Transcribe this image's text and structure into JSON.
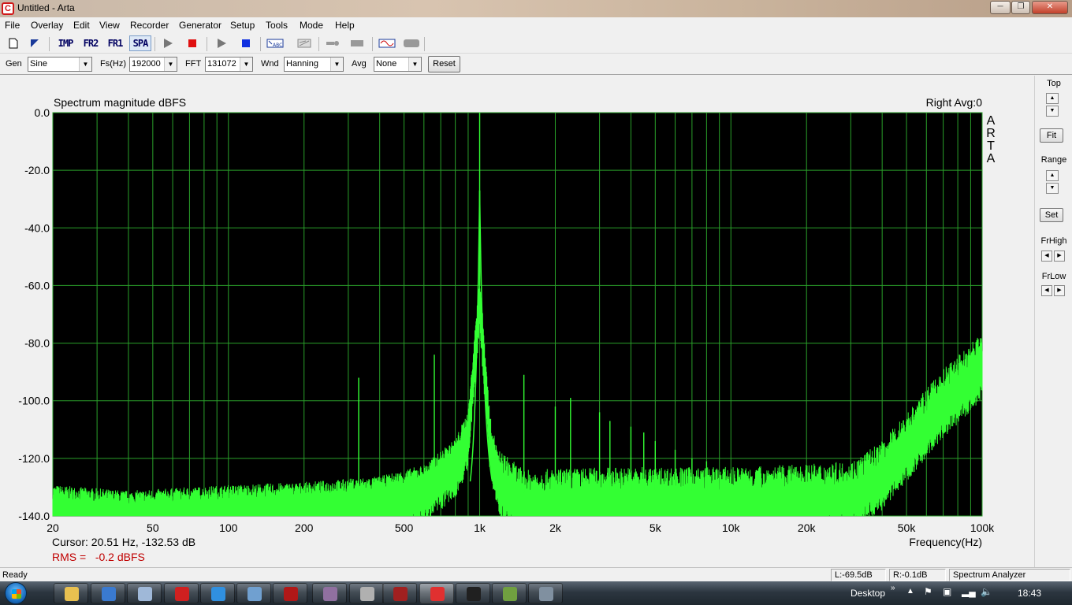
{
  "window": {
    "title": "Untitled - Arta",
    "app_icon_letter": "C"
  },
  "menu": [
    "File",
    "Overlay",
    "Edit",
    "View",
    "Recorder",
    "Generator",
    "Setup",
    "Tools",
    "Mode",
    "Help"
  ],
  "toolbar": {
    "buttons": [
      {
        "name": "new-file-icon",
        "type": "icon"
      },
      {
        "name": "open-file-icon",
        "type": "icon"
      },
      {
        "name": "imp-mode-button",
        "label": "IMP",
        "type": "text"
      },
      {
        "name": "fr2-mode-button",
        "label": "FR2",
        "type": "text"
      },
      {
        "name": "fr1-mode-button",
        "label": "FR1",
        "type": "text"
      },
      {
        "name": "spa-mode-button",
        "label": "SPA",
        "type": "text",
        "active": true
      },
      {
        "name": "play-icon",
        "type": "icon"
      },
      {
        "name": "stop-icon",
        "type": "icon"
      },
      {
        "name": "play-icon",
        "type": "icon"
      },
      {
        "name": "stop-icon",
        "type": "icon"
      },
      {
        "name": "abc-icon",
        "type": "icon"
      },
      {
        "name": "calibrate-icon",
        "type": "icon"
      },
      {
        "name": "probe-icon",
        "type": "icon"
      },
      {
        "name": "bar-icon",
        "type": "icon"
      },
      {
        "name": "generator-icon",
        "type": "icon"
      },
      {
        "name": "record-icon",
        "type": "icon"
      }
    ]
  },
  "controls": {
    "gen_label": "Gen",
    "gen_value": "Sine",
    "fs_label": "Fs(Hz)",
    "fs_value": "192000",
    "fft_label": "FFT",
    "fft_value": "131072",
    "wnd_label": "Wnd",
    "wnd_value": "Hanning",
    "avg_label": "Avg",
    "avg_value": "None",
    "reset_label": "Reset"
  },
  "plot": {
    "info_right": "Right  Avg:0",
    "watermark": "ARTA",
    "cursor_text": "Cursor: 20.51 Hz, -132.53 dB",
    "rms_text": "RMS =   -0.2 dBFS",
    "colors": {
      "background": "#000000",
      "grid": "#2aa02a",
      "trace": "#33ff33",
      "rms": "#c00000"
    }
  },
  "chart_data": {
    "type": "line",
    "title": "Spectrum magnitude dBFS",
    "xlabel": "Frequency(Hz)",
    "ylabel": "",
    "xscale": "log",
    "xlim": [
      20,
      100000
    ],
    "ylim": [
      -140,
      0
    ],
    "xticks": [
      {
        "v": 20,
        "label": "20"
      },
      {
        "v": 50,
        "label": "50"
      },
      {
        "v": 100,
        "label": "100"
      },
      {
        "v": 200,
        "label": "200"
      },
      {
        "v": 500,
        "label": "500"
      },
      {
        "v": 1000,
        "label": "1k"
      },
      {
        "v": 2000,
        "label": "2k"
      },
      {
        "v": 5000,
        "label": "5k"
      },
      {
        "v": 10000,
        "label": "10k"
      },
      {
        "v": 20000,
        "label": "20k"
      },
      {
        "v": 50000,
        "label": "50k"
      },
      {
        "v": 100000,
        "label": "100k"
      }
    ],
    "yticks": [
      {
        "v": 0,
        "label": "0.0"
      },
      {
        "v": -20,
        "label": "-20.0"
      },
      {
        "v": -40,
        "label": "-40.0"
      },
      {
        "v": -60,
        "label": "-60.0"
      },
      {
        "v": -80,
        "label": "-80.0"
      },
      {
        "v": -100,
        "label": "-100.0"
      },
      {
        "v": -120,
        "label": "-120.0"
      },
      {
        "v": -140,
        "label": "-140.0"
      }
    ],
    "grid": true,
    "noise_floor": [
      [
        20,
        -134
      ],
      [
        40,
        -136
      ],
      [
        100,
        -134
      ],
      [
        200,
        -133
      ],
      [
        400,
        -131
      ],
      [
        600,
        -127
      ],
      [
        800,
        -118
      ],
      [
        900,
        -108
      ],
      [
        1000,
        -60
      ],
      [
        1100,
        -110
      ],
      [
        1200,
        -125
      ],
      [
        1500,
        -132
      ],
      [
        3000,
        -131
      ],
      [
        10000,
        -131
      ],
      [
        20000,
        -130
      ],
      [
        30000,
        -129
      ],
      [
        40000,
        -122
      ],
      [
        50000,
        -112
      ],
      [
        70000,
        -97
      ],
      [
        100000,
        -84
      ]
    ],
    "peaks": [
      {
        "f": 1000,
        "db": 0
      },
      {
        "f": 1000,
        "db": -27
      },
      {
        "f": 330,
        "db": -92
      },
      {
        "f": 660,
        "db": -84
      },
      {
        "f": 1500,
        "db": -91
      },
      {
        "f": 2000,
        "db": -102
      },
      {
        "f": 2300,
        "db": -99
      },
      {
        "f": 3000,
        "db": -104
      },
      {
        "f": 3300,
        "db": -107
      },
      {
        "f": 4000,
        "db": -109
      },
      {
        "f": 4500,
        "db": -111
      },
      {
        "f": 5000,
        "db": -114
      },
      {
        "f": 6000,
        "db": -117
      },
      {
        "f": 7000,
        "db": -120
      },
      {
        "f": 8000,
        "db": -121
      }
    ]
  },
  "right_panel": {
    "top_label": "Top",
    "fit_label": "Fit",
    "range_label": "Range",
    "set_label": "Set",
    "frhigh_label": "FrHigh",
    "frlow_label": "FrLow"
  },
  "status": {
    "ready": "Ready",
    "left": "L:-69.5dB",
    "right": "R:-0.1dB",
    "mode": "Spectrum Analyzer"
  },
  "taskbar": {
    "desktop_label": "Desktop",
    "clock": "18:43",
    "apps": [
      {
        "name": "explorer-icon",
        "color": "#e8c050"
      },
      {
        "name": "media-player-icon",
        "color": "#3a7ad0"
      },
      {
        "name": "calculator-icon",
        "color": "#9fb8d8"
      },
      {
        "name": "opera-icon",
        "color": "#d02020"
      },
      {
        "name": "browser-icon",
        "color": "#3090e0"
      },
      {
        "name": "window-icon",
        "color": "#70a0d0"
      },
      {
        "name": "pdf-icon",
        "color": "#b01818"
      },
      {
        "name": "tool-icon",
        "color": "#9070a0"
      },
      {
        "name": "document-icon",
        "color": "#b0b0b0"
      },
      {
        "name": "audio-icon",
        "color": "#a02020"
      },
      {
        "name": "arta-icon",
        "color": "#e03030",
        "active": true
      },
      {
        "name": "terminal-icon",
        "color": "#202020"
      },
      {
        "name": "installer-icon",
        "color": "#70a040"
      },
      {
        "name": "network-icon",
        "color": "#8090a0"
      }
    ]
  }
}
